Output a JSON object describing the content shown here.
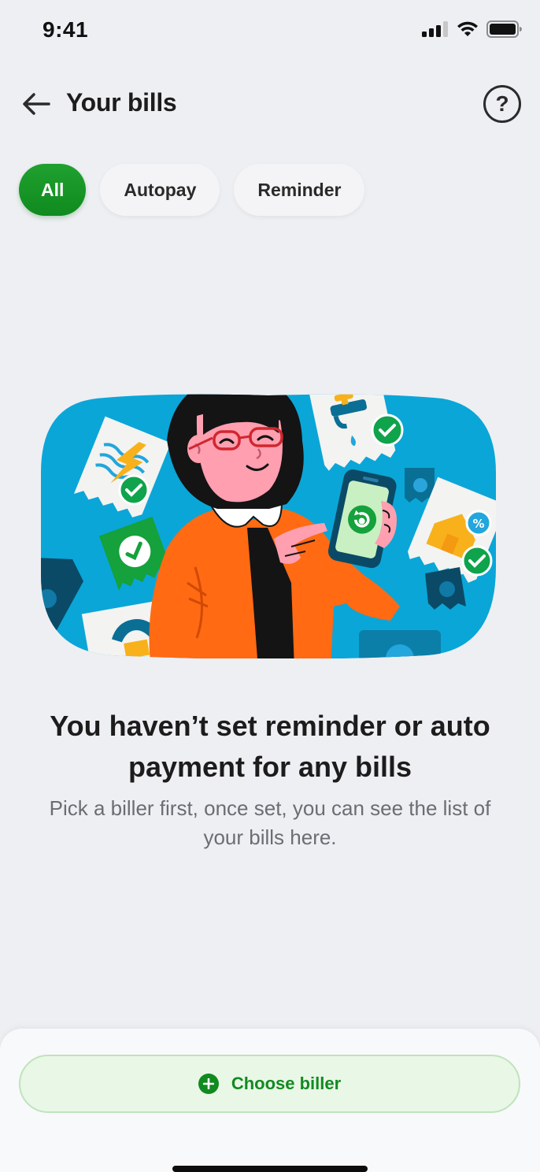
{
  "status_bar": {
    "time": "9:41",
    "icons": [
      "cellular-signal-icon",
      "wifi-icon",
      "battery-icon"
    ]
  },
  "header": {
    "title": "Your bills",
    "back_icon": "arrow-left-icon",
    "help_label": "?",
    "help_icon": "help-circle-icon"
  },
  "filters": {
    "chips": [
      {
        "label": "All",
        "selected": true
      },
      {
        "label": "Autopay",
        "selected": false
      },
      {
        "label": "Reminder",
        "selected": false
      }
    ]
  },
  "empty_state": {
    "illustration": "woman-managing-bills-on-phone-illustration",
    "title": "You haven’t set reminder or auto payment for any bills",
    "subtitle": "Pick a biller first, once set, you can see the list of your bills here."
  },
  "footer": {
    "choose_biller_label": "Choose biller",
    "choose_biller_icon": "plus-circle-icon"
  },
  "colors": {
    "accent_green": "#1a9a2a",
    "background": "#eeeff3",
    "illustration_blue": "#0aa6d8",
    "jacket_orange": "#ff6a13"
  }
}
